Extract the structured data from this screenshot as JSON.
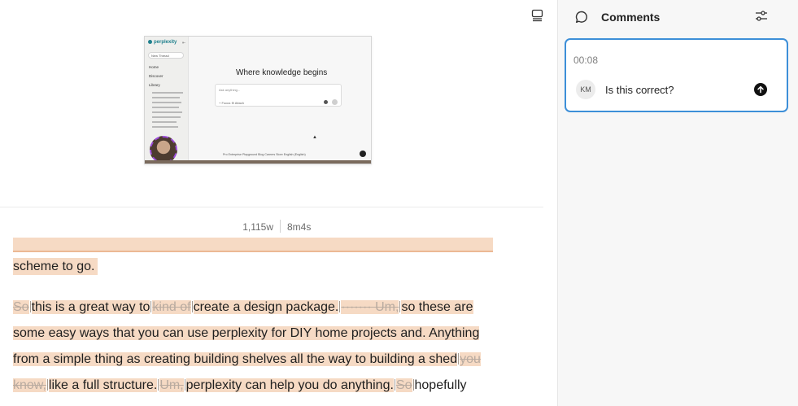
{
  "stats": {
    "word_count": "1,115w",
    "duration": "8m4s"
  },
  "video_preview": {
    "app_name": "perplexity",
    "collapse_glyph": "⇤",
    "new_thread": "New Thread",
    "nav": [
      "Home",
      "Discover",
      "Library"
    ],
    "headline": "Where knowledge begins",
    "input_placeholder": "Ask anything...",
    "input_options": "+ Focus   ⊕ Attach",
    "footer": "Pro  Enterprise  Playground  Blog  Careers  Store  English (English)"
  },
  "transcript": {
    "top_text": "scheme to go.",
    "lines": [
      [
        {
          "t": "So",
          "cut": true
        },
        {
          "t": "this is a great way to"
        },
        {
          "t": "kind of",
          "cut": true
        },
        {
          "t": "create a design package."
        },
        {
          "t": "······· Um,",
          "cut": true
        },
        {
          "t": "so these are"
        }
      ],
      [
        {
          "t": "some easy ways that you can use perplexity for DIY home projects and. Anything"
        }
      ],
      [
        {
          "t": "from a simple thing as creating building shelves all the way to building a shed"
        },
        {
          "t": "you",
          "cut": true
        }
      ],
      [
        {
          "t": "know,",
          "cut": true
        },
        {
          "t": "like a full structure."
        },
        {
          "t": "Um,",
          "cut": true
        },
        {
          "t": "perplexity can help you do anything."
        },
        {
          "t": "So",
          "cut": true
        },
        {
          "t": "hopefully",
          "plain": true
        }
      ]
    ]
  },
  "comments": {
    "title": "Comments",
    "items": [
      {
        "timestamp": "00:08",
        "author_initials": "KM",
        "text": "Is this correct?"
      }
    ]
  },
  "icons": {
    "layout": "layout-toggle-icon",
    "comment": "speech-bubble-icon",
    "filter": "sliders-icon",
    "send": "arrow-up-icon"
  },
  "colors": {
    "highlight": "#f6dac4",
    "accent_border": "#3d8fd8",
    "strike": "#b9aba0"
  }
}
